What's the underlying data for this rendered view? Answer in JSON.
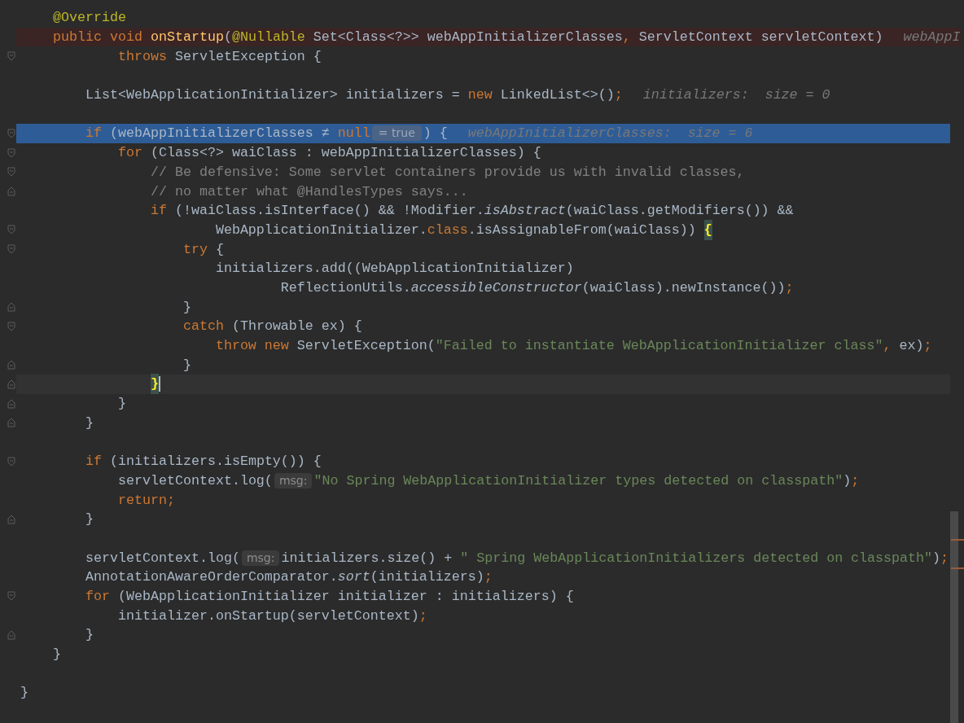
{
  "editor": {
    "lines": [
      {
        "kind": "normal",
        "fold_start": false,
        "fold_end": false,
        "tokens": [
          {
            "text": "    @Override",
            "kind": "annotation"
          }
        ]
      },
      {
        "kind": "breakpoint",
        "fold_start": false,
        "fold_end": false,
        "tokens": [
          {
            "text": "    public void ",
            "kind": "keyword"
          },
          {
            "text": "onStartup",
            "kind": "method"
          },
          {
            "text": "(",
            "kind": "plain"
          },
          {
            "text": "@Nullable",
            "kind": "annotation"
          },
          {
            "text": " Set<Class<?>> webAppInitializerClasses",
            "kind": "plain"
          },
          {
            "text": ",",
            "kind": "keyword"
          },
          {
            "text": " ServletContext servletContext)",
            "kind": "plain"
          },
          {
            "text": "webAppI",
            "kind": "debug_hint"
          }
        ]
      },
      {
        "kind": "normal",
        "fold_start": true,
        "fold_end": false,
        "tokens": [
          {
            "text": "            throws",
            "kind": "keyword"
          },
          {
            "text": " ServletException {",
            "kind": "plain"
          }
        ]
      },
      {
        "kind": "normal",
        "fold_start": false,
        "fold_end": false
      },
      {
        "kind": "normal",
        "fold_start": false,
        "fold_end": false,
        "tokens": [
          {
            "text": "        List<WebApplicationInitializer> initializers = ",
            "kind": "plain"
          },
          {
            "text": "new",
            "kind": "keyword"
          },
          {
            "text": " LinkedList<>()",
            "kind": "plain"
          },
          {
            "text": ";",
            "kind": "keyword"
          },
          {
            "text": "initializers:  size = 0",
            "kind": "debug_hint"
          }
        ]
      },
      {
        "kind": "normal",
        "fold_start": false,
        "fold_end": false
      },
      {
        "kind": "execution",
        "fold_start": true,
        "fold_end": false,
        "tokens": [
          {
            "text": "        if",
            "kind": "keyword"
          },
          {
            "text": " (webAppInitializerClasses ≠ ",
            "kind": "plain"
          },
          {
            "text": "null",
            "kind": "keyword"
          },
          {
            "text": "= true",
            "kind": "inline_value"
          },
          {
            "text": ") {",
            "kind": "plain"
          },
          {
            "text": "webAppInitializerClasses:  size = 6",
            "kind": "debug_hint"
          }
        ]
      },
      {
        "kind": "normal",
        "fold_start": true,
        "fold_end": false,
        "tokens": [
          {
            "text": "            for",
            "kind": "keyword"
          },
          {
            "text": " (Class<?> waiClass : webAppInitializerClasses) {",
            "kind": "plain"
          }
        ]
      },
      {
        "kind": "normal",
        "fold_start": true,
        "fold_end": false,
        "tokens": [
          {
            "text": "                // Be defensive: Some servlet containers provide us with invalid classes,",
            "kind": "comment"
          }
        ]
      },
      {
        "kind": "normal",
        "fold_start": false,
        "fold_end": true,
        "tokens": [
          {
            "text": "                // no matter what @HandlesTypes says...",
            "kind": "comment"
          }
        ]
      },
      {
        "kind": "normal",
        "fold_start": false,
        "fold_end": false,
        "tokens": [
          {
            "text": "                if",
            "kind": "keyword"
          },
          {
            "text": " (!waiClass.isInterface() && !Modifier.",
            "kind": "plain"
          },
          {
            "text": "isAbstract",
            "kind": "static"
          },
          {
            "text": "(waiClass.getModifiers()) &&",
            "kind": "plain"
          }
        ]
      },
      {
        "kind": "normal",
        "fold_start": true,
        "fold_end": false,
        "tokens": [
          {
            "text": "                        WebApplicationInitializer.",
            "kind": "plain"
          },
          {
            "text": "class",
            "kind": "keyword"
          },
          {
            "text": ".isAssignableFrom(waiClass)) ",
            "kind": "plain"
          },
          {
            "text": "{",
            "kind": "brace_match"
          }
        ]
      },
      {
        "kind": "normal",
        "fold_start": true,
        "fold_end": false,
        "tokens": [
          {
            "text": "                    try",
            "kind": "keyword"
          },
          {
            "text": " {",
            "kind": "plain"
          }
        ]
      },
      {
        "kind": "normal",
        "fold_start": false,
        "fold_end": false,
        "tokens": [
          {
            "text": "                        initializers.add((WebApplicationInitializer)",
            "kind": "plain"
          }
        ]
      },
      {
        "kind": "normal",
        "fold_start": false,
        "fold_end": false,
        "tokens": [
          {
            "text": "                                ReflectionUtils.",
            "kind": "plain"
          },
          {
            "text": "accessibleConstructor",
            "kind": "static"
          },
          {
            "text": "(waiClass).newInstance())",
            "kind": "plain"
          },
          {
            "text": ";",
            "kind": "keyword"
          }
        ]
      },
      {
        "kind": "normal",
        "fold_start": false,
        "fold_end": true,
        "tokens": [
          {
            "text": "                    }",
            "kind": "plain"
          }
        ]
      },
      {
        "kind": "normal",
        "fold_start": true,
        "fold_end": false,
        "tokens": [
          {
            "text": "                    catch",
            "kind": "keyword"
          },
          {
            "text": " (Throwable ex) {",
            "kind": "plain"
          }
        ]
      },
      {
        "kind": "normal",
        "fold_start": false,
        "fold_end": false,
        "tokens": [
          {
            "text": "                        throw new",
            "kind": "keyword"
          },
          {
            "text": " ServletException(",
            "kind": "plain"
          },
          {
            "text": "\"Failed to instantiate WebApplicationInitializer class\"",
            "kind": "string"
          },
          {
            "text": ",",
            "kind": "keyword"
          },
          {
            "text": " ex)",
            "kind": "plain"
          },
          {
            "text": ";",
            "kind": "keyword"
          }
        ]
      },
      {
        "kind": "normal",
        "fold_start": false,
        "fold_end": true,
        "tokens": [
          {
            "text": "                    }",
            "kind": "plain"
          }
        ]
      },
      {
        "kind": "caret",
        "fold_start": false,
        "fold_end": true,
        "tokens": [
          {
            "text": "                }",
            "kind": "brace_match"
          }
        ]
      },
      {
        "kind": "normal",
        "fold_start": false,
        "fold_end": true,
        "tokens": [
          {
            "text": "            }",
            "kind": "plain"
          }
        ]
      },
      {
        "kind": "normal",
        "fold_start": false,
        "fold_end": true,
        "tokens": [
          {
            "text": "        }",
            "kind": "plain"
          }
        ]
      },
      {
        "kind": "normal",
        "fold_start": false,
        "fold_end": false
      },
      {
        "kind": "normal",
        "fold_start": true,
        "fold_end": false,
        "tokens": [
          {
            "text": "        if",
            "kind": "keyword"
          },
          {
            "text": " (initializers.isEmpty()) {",
            "kind": "plain"
          }
        ]
      },
      {
        "kind": "normal",
        "fold_start": false,
        "fold_end": false,
        "tokens": [
          {
            "text": "            servletContext.log(",
            "kind": "plain"
          },
          {
            "text": "msg:",
            "kind": "param_hint"
          },
          {
            "text": "\"No Spring WebApplicationInitializer types detected on classpath\"",
            "kind": "string"
          },
          {
            "text": ")",
            "kind": "plain"
          },
          {
            "text": ";",
            "kind": "keyword"
          }
        ]
      },
      {
        "kind": "normal",
        "fold_start": false,
        "fold_end": false,
        "tokens": [
          {
            "text": "            return;",
            "kind": "keyword"
          }
        ]
      },
      {
        "kind": "normal",
        "fold_start": false,
        "fold_end": true,
        "tokens": [
          {
            "text": "        }",
            "kind": "plain"
          }
        ]
      },
      {
        "kind": "normal",
        "fold_start": false,
        "fold_end": false
      },
      {
        "kind": "normal",
        "fold_start": false,
        "fold_end": false,
        "tokens": [
          {
            "text": "        servletContext.log(",
            "kind": "plain"
          },
          {
            "text": "msg:",
            "kind": "param_hint"
          },
          {
            "text": "initializers.size() + ",
            "kind": "plain"
          },
          {
            "text": "\" Spring WebApplicationInitializers detected on classpath\"",
            "kind": "string"
          },
          {
            "text": ")",
            "kind": "plain"
          },
          {
            "text": ";",
            "kind": "keyword"
          }
        ]
      },
      {
        "kind": "normal",
        "fold_start": false,
        "fold_end": false,
        "tokens": [
          {
            "text": "        AnnotationAwareOrderComparator.",
            "kind": "plain"
          },
          {
            "text": "sort",
            "kind": "static"
          },
          {
            "text": "(initializers)",
            "kind": "plain"
          },
          {
            "text": ";",
            "kind": "keyword"
          }
        ]
      },
      {
        "kind": "normal",
        "fold_start": true,
        "fold_end": false,
        "tokens": [
          {
            "text": "        for",
            "kind": "keyword"
          },
          {
            "text": " (WebApplicationInitializer initializer : initializers) {",
            "kind": "plain"
          }
        ]
      },
      {
        "kind": "normal",
        "fold_start": false,
        "fold_end": false,
        "tokens": [
          {
            "text": "            initializer.onStartup(servletContext)",
            "kind": "plain"
          },
          {
            "text": ";",
            "kind": "keyword"
          }
        ]
      },
      {
        "kind": "normal",
        "fold_start": false,
        "fold_end": true,
        "tokens": [
          {
            "text": "        }",
            "kind": "plain"
          }
        ]
      },
      {
        "kind": "normal",
        "fold_start": false,
        "fold_end": false,
        "tokens": [
          {
            "text": "    }",
            "kind": "plain"
          }
        ]
      },
      {
        "kind": "normal",
        "fold_start": false,
        "fold_end": false
      },
      {
        "kind": "normal",
        "fold_start": false,
        "fold_end": false,
        "tokens": [
          {
            "text": "}",
            "kind": "plain"
          }
        ]
      }
    ]
  }
}
